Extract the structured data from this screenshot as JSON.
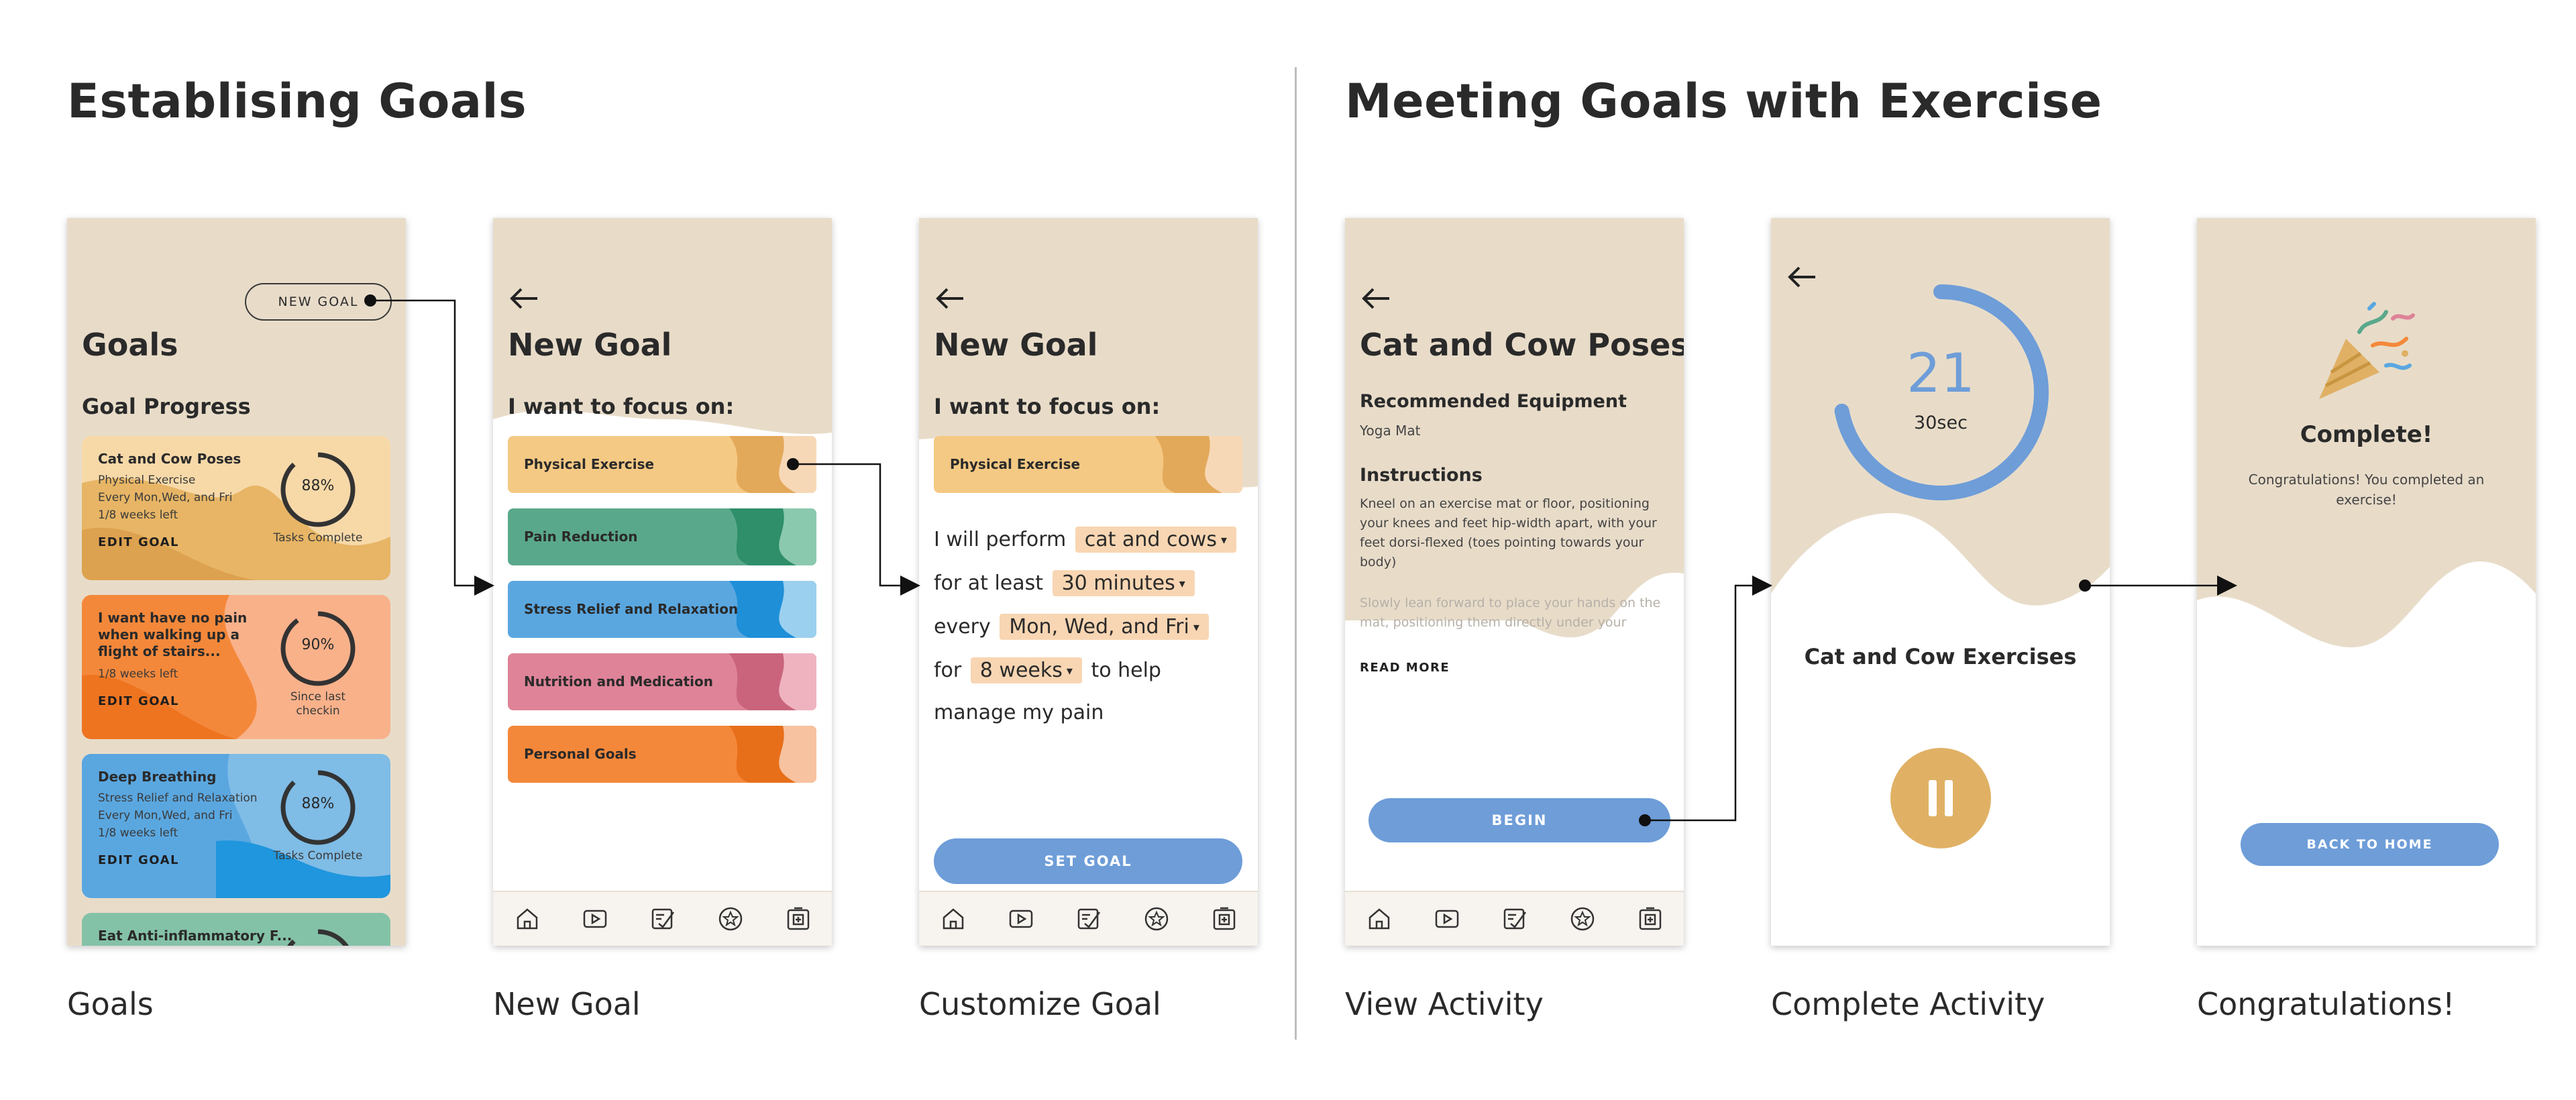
{
  "sections": {
    "left_title": "Establising Goals",
    "right_title": "Meeting Goals with Exercise"
  },
  "captions": [
    "Goals",
    "New Goal",
    "Customize Goal",
    "View Activity",
    "Complete Activity",
    "Congratulations!"
  ],
  "colors": {
    "beige": "#e8dcc9",
    "blue": "#6e9dd8",
    "gold": "#e0b165",
    "orange": "#f4883a",
    "green": "#5aa88b",
    "sky": "#5aa7e0",
    "pink": "#de8398"
  },
  "goals_screen": {
    "new_goal_button": "NEW GOAL",
    "title": "Goals",
    "subtitle": "Goal Progress",
    "cards": [
      {
        "title": "Cat and Cow Poses",
        "lines": [
          "Physical Exercise",
          "Every Mon,Wed, and Fri",
          "1/8 weeks left"
        ],
        "edit": "EDIT GOAL",
        "progress": 88,
        "progress_text": "88%",
        "progress_label": "Tasks Complete"
      },
      {
        "title": "I want have no pain when walking up a flight of stairs...",
        "lines": [
          "1/8 weeks left"
        ],
        "edit": "EDIT GOAL",
        "progress": 90,
        "progress_text": "90%",
        "progress_label": "Since last checkin"
      },
      {
        "title": "Deep Breathing",
        "lines": [
          "Stress Relief and Relaxation",
          "Every Mon,Wed, and Fri",
          "1/8 weeks left"
        ],
        "edit": "EDIT GOAL",
        "progress": 88,
        "progress_text": "88%",
        "progress_label": "Tasks Complete"
      },
      {
        "title": "Eat Anti-inflammatory F..."
      }
    ]
  },
  "new_goal_screen": {
    "title": "New Goal",
    "subtitle": "I want to focus on:",
    "categories": [
      "Physical Exercise",
      "Pain Reduction",
      "Stress Relief and Relaxation",
      "Nutrition and Medication",
      "Personal Goals"
    ]
  },
  "customize_screen": {
    "title": "New Goal",
    "subtitle": "I want to focus on:",
    "selected": "Physical Exercise",
    "s1": "I will perform",
    "activity": "cat and cows",
    "s2": "for at  least",
    "duration": "30 minutes",
    "s3": "every",
    "days": "Mon, Wed, and Fri",
    "s4": "for",
    "weeks": "8 weeks",
    "s5": "to help",
    "s6": "manage my pain",
    "button": "SET GOAL"
  },
  "activity_screen": {
    "title": "Cat and Cow Poses",
    "equipment_heading": "Recommended Equipment",
    "equipment": "Yoga Mat",
    "instructions_heading": "Instructions",
    "instructions": "Kneel on an exercise mat or floor, positioning your knees and feet hip-width apart, with your feet dorsi-flexed (toes pointing towards your body)",
    "instructions_more": "Slowly lean forward to place your hands on the mat, positioning them directly under your",
    "read_more": "READ MORE",
    "button": "BEGIN"
  },
  "timer_screen": {
    "count": "21",
    "unit": "30sec",
    "progress": 0.72,
    "title": "Cat and Cow Exercises"
  },
  "congrats_screen": {
    "title": "Complete!",
    "message": "Congratulations! You completed an exercise!",
    "button": "BACK TO HOME"
  },
  "nav_icons": [
    "home-icon",
    "play-icon",
    "checklist-icon",
    "star-icon",
    "medical-plus-icon"
  ]
}
